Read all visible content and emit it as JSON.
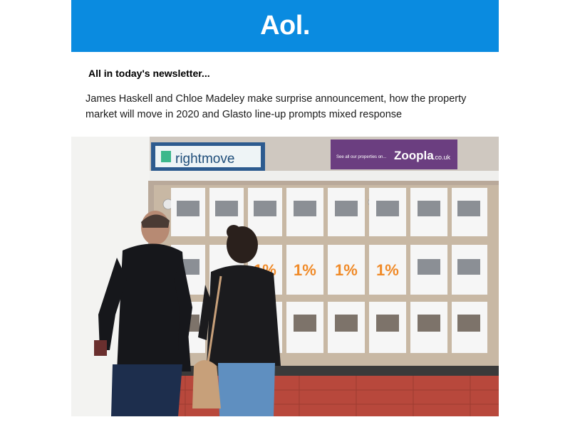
{
  "header": {
    "logo_text": "Aol.",
    "bg_color": "#0a8be0"
  },
  "intro": {
    "heading": "All in today's newsletter...",
    "summary": "James Haskell and Chloe Madeley make surprise announcement, how the property market will move in 2020 and Glasto line-up prompts mixed response"
  },
  "hero": {
    "sign_left": "rightmove",
    "sign_right_small": "See all our properties on...",
    "sign_right_brand": "Zoopla",
    "sign_right_suffix": ".co.uk",
    "listing_rate": "1%"
  }
}
